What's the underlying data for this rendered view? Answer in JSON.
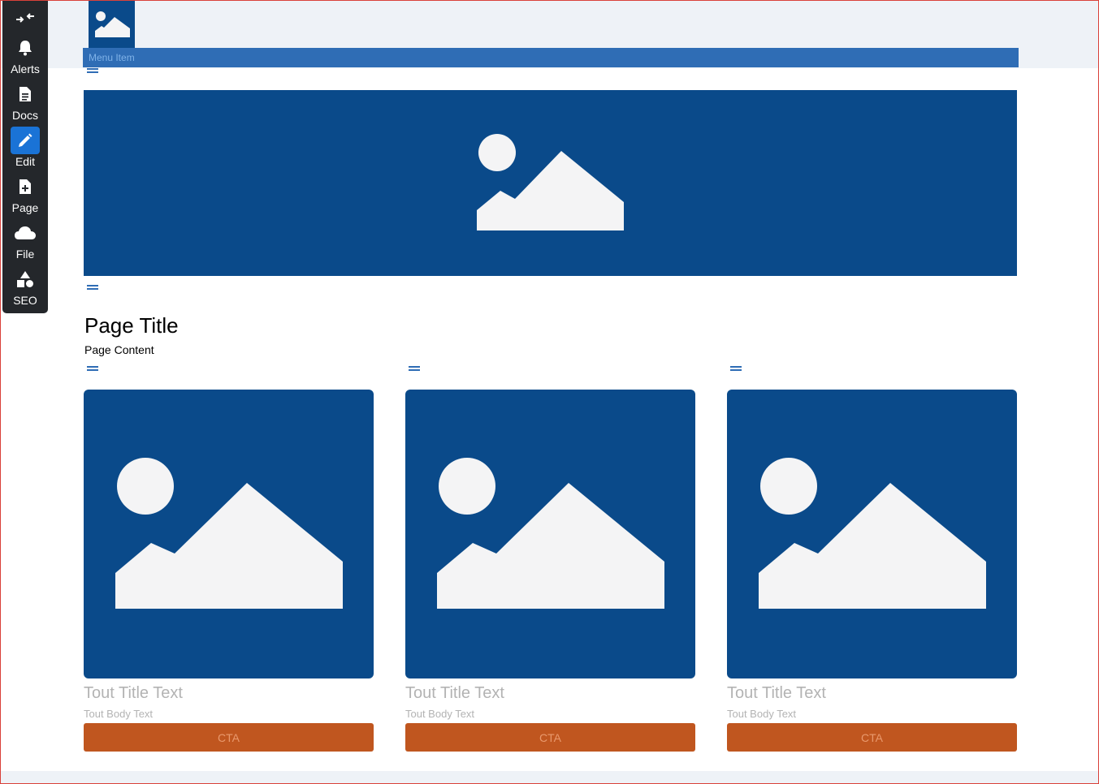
{
  "sidebar": {
    "items": [
      {
        "label": "",
        "icon": "collapse-arrows-icon"
      },
      {
        "label": "Alerts",
        "icon": "bell-icon"
      },
      {
        "label": "Docs",
        "icon": "document-icon"
      },
      {
        "label": "Edit",
        "icon": "pencil-icon",
        "active": true
      },
      {
        "label": "Page",
        "icon": "add-file-icon"
      },
      {
        "label": "File",
        "icon": "cloud-icon"
      },
      {
        "label": "SEO",
        "icon": "shapes-icon"
      }
    ]
  },
  "header": {
    "logo_icon": "image-placeholder-icon",
    "menu": {
      "item_label": "Menu Item"
    }
  },
  "hero": {
    "icon": "image-placeholder-icon"
  },
  "page": {
    "title": "Page Title",
    "content": "Page Content"
  },
  "touts": [
    {
      "title": "Tout Title Text",
      "body": "Tout Body Text",
      "cta": "CTA"
    },
    {
      "title": "Tout Title Text",
      "body": "Tout Body Text",
      "cta": "CTA"
    },
    {
      "title": "Tout Title Text",
      "body": "Tout Body Text",
      "cta": "CTA"
    }
  ],
  "colors": {
    "sidebar_bg": "#24272b",
    "active_accent": "#1a73d6",
    "brand_blue": "#0a4a8a",
    "menu_bar": "#2f6db5",
    "cta_orange": "#c0561f",
    "frame_border": "#d9413a"
  }
}
